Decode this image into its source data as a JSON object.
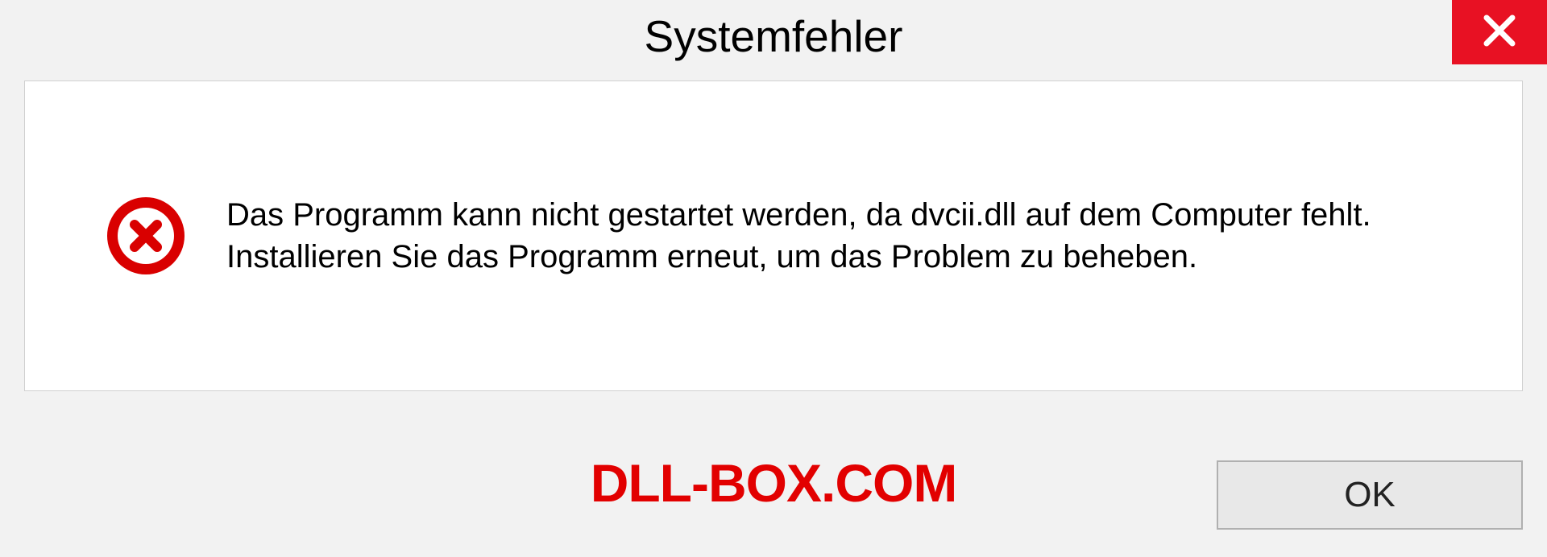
{
  "dialog": {
    "title": "Systemfehler",
    "message": "Das Programm kann nicht gestartet werden, da dvcii.dll auf dem Computer fehlt. Installieren Sie das Programm erneut, um das Problem zu beheben.",
    "ok_label": "OK"
  },
  "watermark": "DLL-BOX.COM",
  "colors": {
    "close_bg": "#e81123",
    "error_icon": "#d90000",
    "watermark": "#e20000"
  }
}
